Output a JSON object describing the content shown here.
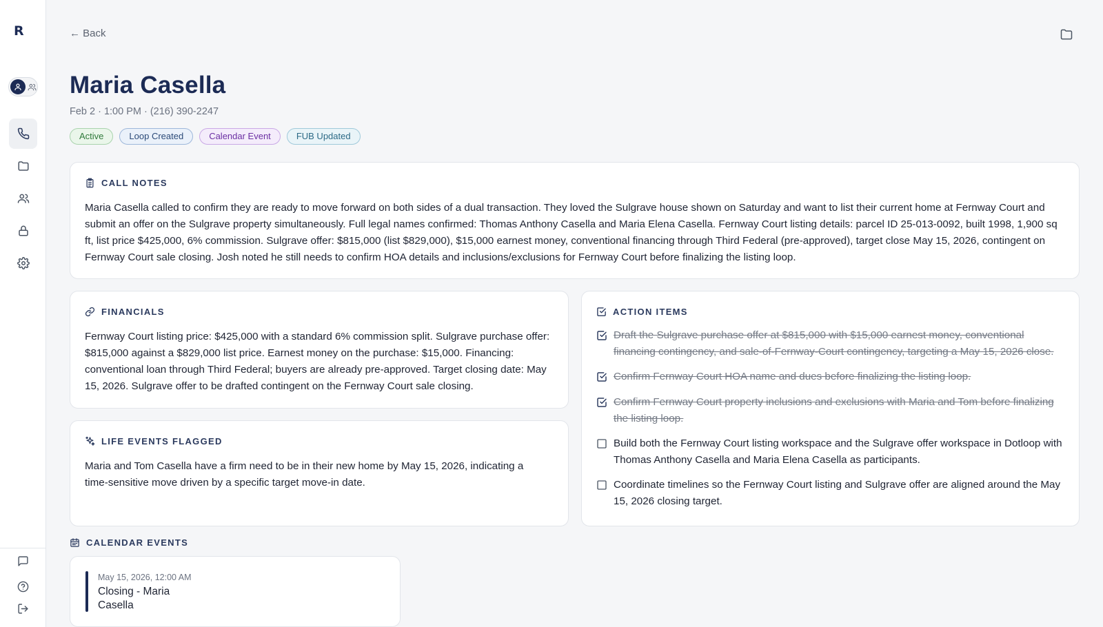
{
  "sidebar": {
    "logo": "R",
    "nav": [
      "phone-icon",
      "folder-icon",
      "users-icon",
      "lock-icon",
      "gear-icon"
    ],
    "bottom": [
      "chat-icon",
      "help-icon",
      "logout-icon"
    ]
  },
  "header": {
    "back_label": "← Back",
    "title": "Maria Casella",
    "subtitle": "Feb 2 · 1:00 PM · (216) 390-2247"
  },
  "badges": [
    {
      "label": "Active",
      "color": "#2f7a3a",
      "bg": "#eaf6ea",
      "border": "#a9d3ad"
    },
    {
      "label": "Loop Created",
      "color": "#2b4a78",
      "bg": "#eaf1fa",
      "border": "#9db7da"
    },
    {
      "label": "Calendar Event",
      "color": "#6b2fa3",
      "bg": "#f4ecfb",
      "border": "#c9a8e6"
    },
    {
      "label": "FUB Updated",
      "color": "#2c6a86",
      "bg": "#e9f4f8",
      "border": "#9fc9da"
    }
  ],
  "call_notes": {
    "heading": "CALL NOTES",
    "text": "Maria Casella called to confirm they are ready to move forward on both sides of a dual transaction. They loved the Sulgrave house shown on Saturday and want to list their current home at Fernway Court and submit an offer on the Sulgrave property simultaneously. Full legal names confirmed: Thomas Anthony Casella and Maria Elena Casella. Fernway Court listing details: parcel ID 25-013-0092, built 1998, 1,900 sq ft, list price $425,000, 6% commission. Sulgrave offer: $815,000 (list $829,000), $15,000 earnest money, conventional financing through Third Federal (pre-approved), target close May 15, 2026, contingent on Fernway Court sale closing. Josh noted he still needs to confirm HOA details and inclusions/exclusions for Fernway Court before finalizing the listing loop."
  },
  "financials": {
    "heading": "FINANCIALS",
    "text": "Fernway Court listing price: $425,000 with a standard 6% commission split. Sulgrave purchase offer: $815,000 against a $829,000 list price. Earnest money on the purchase: $15,000. Financing: conventional loan through Third Federal; buyers are already pre-approved. Target closing date: May 15, 2026. Sulgrave offer to be drafted contingent on the Fernway Court sale closing."
  },
  "life_events": {
    "heading": "LIFE EVENTS FLAGGED",
    "text": "Maria and Tom Casella have a firm need to be in their new home by May 15, 2026, indicating a time-sensitive move driven by a specific target move-in date."
  },
  "action_items": {
    "heading": "ACTION ITEMS",
    "items": [
      {
        "text": "Draft the Sulgrave purchase offer at $815,000 with $15,000 earnest money, conventional financing contingency, and sale-of-Fernway-Court contingency, targeting a May 15, 2026 close.",
        "done": true
      },
      {
        "text": "Confirm Fernway Court HOA name and dues before finalizing the listing loop.",
        "done": true
      },
      {
        "text": "Confirm Fernway Court property inclusions and exclusions with Maria and Tom before finalizing the listing loop.",
        "done": true
      },
      {
        "text": "Build both the Fernway Court listing workspace and the Sulgrave offer workspace in Dotloop with Thomas Anthony Casella and Maria Elena Casella as participants.",
        "done": false
      },
      {
        "text": "Coordinate timelines so the Fernway Court listing and Sulgrave offer are aligned around the May 15, 2026 closing target.",
        "done": false
      }
    ]
  },
  "calendar": {
    "heading": "CALENDAR EVENTS",
    "events": [
      {
        "date": "May 15, 2026, 12:00 AM",
        "title": "Closing - Maria Casella"
      }
    ]
  },
  "colors": {
    "accent": "#1c2b55"
  }
}
